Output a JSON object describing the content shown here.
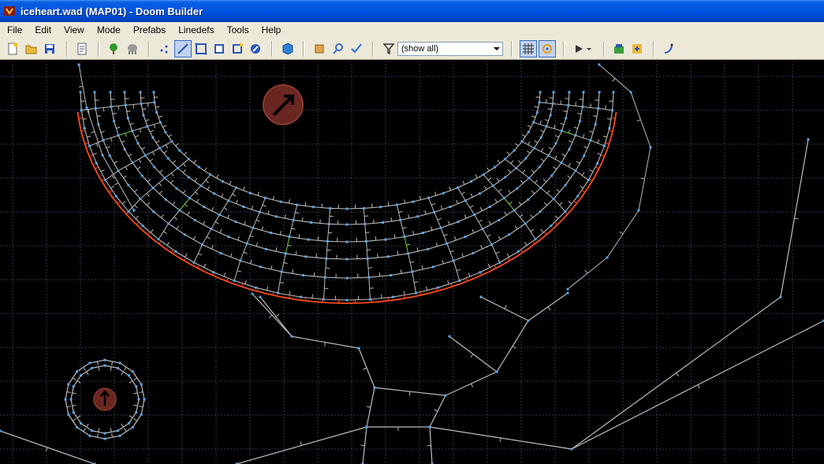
{
  "window": {
    "title": "iceheart.wad (MAP01) - Doom Builder",
    "icon": "doom-builder-app-icon"
  },
  "menu": {
    "items": [
      "File",
      "Edit",
      "View",
      "Mode",
      "Prefabs",
      "Linedefs",
      "Tools",
      "Help"
    ]
  },
  "toolbar": {
    "filter_value": "(show all)",
    "buttons": [
      "new-map-icon",
      "open-map-icon",
      "save-map-icon",
      "map-options-icon",
      "things-tree-icon",
      "things-gray-icon",
      "vertices-mode-icon",
      "linedefs-mode-icon",
      "sectors-mode-icon",
      "things-mode-icon",
      "make-sectors-icon",
      "3d-mode-icon",
      "select-region-icon",
      "zoom-icon",
      "check-map-icon",
      "filter-icon",
      "grid-icon",
      "snap-icon",
      "play-icon",
      "play-dropdown-icon",
      "build-nodes-icon",
      "export-icon",
      "script-icon"
    ],
    "checked": [
      "linedefs-mode-icon",
      "grid-icon",
      "snap-icon"
    ]
  },
  "colors": {
    "title_bar": "#0054e3",
    "chrome": "#ece9d8",
    "map_background": "#000000",
    "grid": "#2b3a4a",
    "linedef": "#bdbdbd",
    "linedef_highlight": "#ff4a1c",
    "linedef_special": "#7ecf3a",
    "vertex": "#5aa8e8",
    "thing_marker": "#7a2a22"
  }
}
